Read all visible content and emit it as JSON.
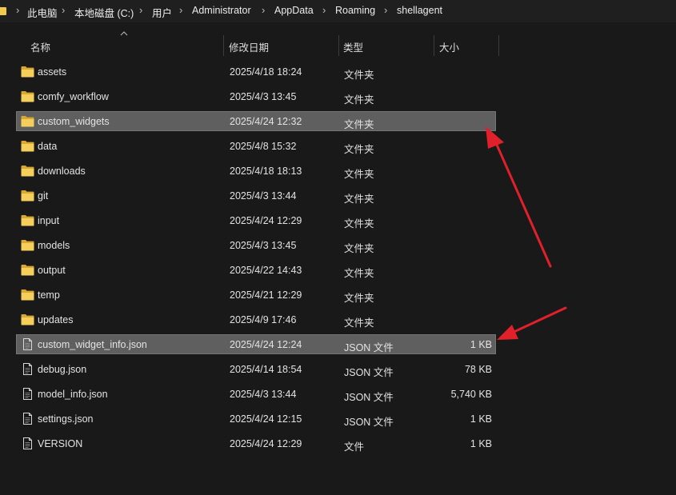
{
  "breadcrumb": {
    "items": [
      "此电脑",
      "本地磁盘 (C:)",
      "用户",
      "Administrator",
      "AppData",
      "Roaming",
      "shellagent"
    ],
    "separator": "›"
  },
  "columns": {
    "name": "名称",
    "date": "修改日期",
    "type": "类型",
    "size": "大小"
  },
  "files": [
    {
      "name": "assets",
      "date": "2025/4/18 18:24",
      "type": "文件夹",
      "size": "",
      "icon": "folder-icon",
      "selected": false
    },
    {
      "name": "comfy_workflow",
      "date": "2025/4/3 13:45",
      "type": "文件夹",
      "size": "",
      "icon": "folder-icon",
      "selected": false
    },
    {
      "name": "custom_widgets",
      "date": "2025/4/24 12:32",
      "type": "文件夹",
      "size": "",
      "icon": "folder-icon",
      "selected": true
    },
    {
      "name": "data",
      "date": "2025/4/8 15:32",
      "type": "文件夹",
      "size": "",
      "icon": "folder-icon",
      "selected": false
    },
    {
      "name": "downloads",
      "date": "2025/4/18 18:13",
      "type": "文件夹",
      "size": "",
      "icon": "folder-icon",
      "selected": false
    },
    {
      "name": "git",
      "date": "2025/4/3 13:44",
      "type": "文件夹",
      "size": "",
      "icon": "folder-icon",
      "selected": false
    },
    {
      "name": "input",
      "date": "2025/4/24 12:29",
      "type": "文件夹",
      "size": "",
      "icon": "folder-icon",
      "selected": false
    },
    {
      "name": "models",
      "date": "2025/4/3 13:45",
      "type": "文件夹",
      "size": "",
      "icon": "folder-icon",
      "selected": false
    },
    {
      "name": "output",
      "date": "2025/4/22 14:43",
      "type": "文件夹",
      "size": "",
      "icon": "folder-icon",
      "selected": false
    },
    {
      "name": "temp",
      "date": "2025/4/21 12:29",
      "type": "文件夹",
      "size": "",
      "icon": "folder-icon",
      "selected": false
    },
    {
      "name": "updates",
      "date": "2025/4/9 17:46",
      "type": "文件夹",
      "size": "",
      "icon": "folder-icon",
      "selected": false
    },
    {
      "name": "custom_widget_info.json",
      "date": "2025/4/24 12:24",
      "type": "JSON 文件",
      "size": "1 KB",
      "icon": "file-icon",
      "selected": true
    },
    {
      "name": "debug.json",
      "date": "2025/4/14 18:54",
      "type": "JSON 文件",
      "size": "78 KB",
      "icon": "file-icon",
      "selected": false
    },
    {
      "name": "model_info.json",
      "date": "2025/4/3 13:44",
      "type": "JSON 文件",
      "size": "5,740 KB",
      "icon": "file-icon",
      "selected": false
    },
    {
      "name": "settings.json",
      "date": "2025/4/24 12:15",
      "type": "JSON 文件",
      "size": "1 KB",
      "icon": "file-icon",
      "selected": false
    },
    {
      "name": "VERSION",
      "date": "2025/4/24 12:29",
      "type": "文件",
      "size": "1 KB",
      "icon": "file-icon",
      "selected": false
    }
  ],
  "colors": {
    "background": "#191919",
    "selection": "#5f5f5f",
    "folder": "#f2c94c",
    "annotation_arrow": "#e0202a"
  }
}
